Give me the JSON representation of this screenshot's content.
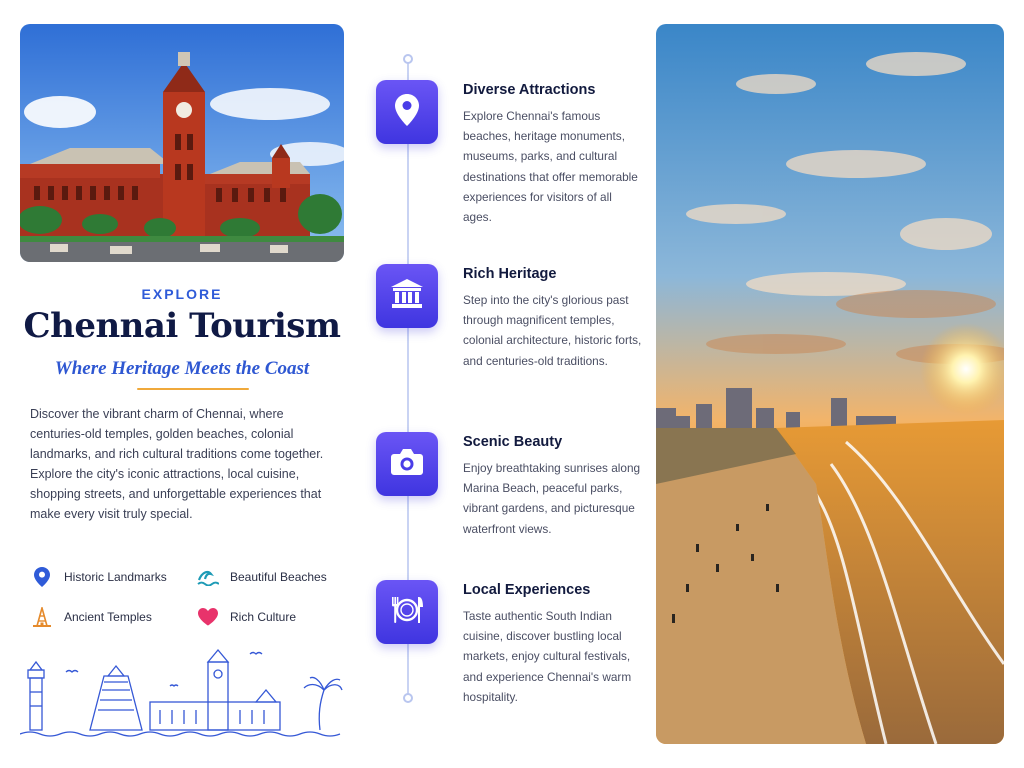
{
  "header": {
    "eyebrow": "EXPLORE",
    "title": "Chennai Tourism",
    "tagline": "Where Heritage Meets the Coast"
  },
  "intro": "Discover the vibrant charm of Chennai, where centuries-old temples, golden beaches, colonial landmarks, and rich cultural traditions come together. Explore the city's iconic attractions, local cuisine, shopping streets, and unforgettable experiences that make every visit truly special.",
  "highlights": [
    {
      "label": "Historic Landmarks",
      "icon": "location-pin-icon"
    },
    {
      "label": "Beautiful Beaches",
      "icon": "waves-icon"
    },
    {
      "label": "Ancient Temples",
      "icon": "temple-icon"
    },
    {
      "label": "Rich Culture",
      "icon": "heart-icon"
    }
  ],
  "steps": [
    {
      "title": "Diverse Attractions",
      "text": "Explore Chennai's famous beaches, heritage monuments, museums, parks, and cultural destinations that offer memorable experiences for visitors of all ages.",
      "icon": "location-pin-icon"
    },
    {
      "title": "Rich Heritage",
      "text": "Step into the city's glorious past through magnificent temples, colonial architecture, historic forts, and centuries-old traditions.",
      "icon": "museum-icon"
    },
    {
      "title": "Scenic Beauty",
      "text": "Enjoy breathtaking sunrises along Marina Beach, peaceful parks, vibrant gardens, and picturesque waterfront views.",
      "icon": "camera-icon"
    },
    {
      "title": "Local Experiences",
      "text": "Taste authentic South Indian cuisine, discover bustling local markets, enjoy cultural festivals, and experience Chennai's warm hospitality.",
      "icon": "dining-icon"
    }
  ],
  "colors": {
    "accent_blue": "#2f5bd8",
    "title_navy": "#101a45",
    "icon_gradient_top": "#6a55f5",
    "icon_gradient_bottom": "#3f35e0",
    "rule_orange": "#f0a93b",
    "heart_pink": "#e8336b"
  }
}
